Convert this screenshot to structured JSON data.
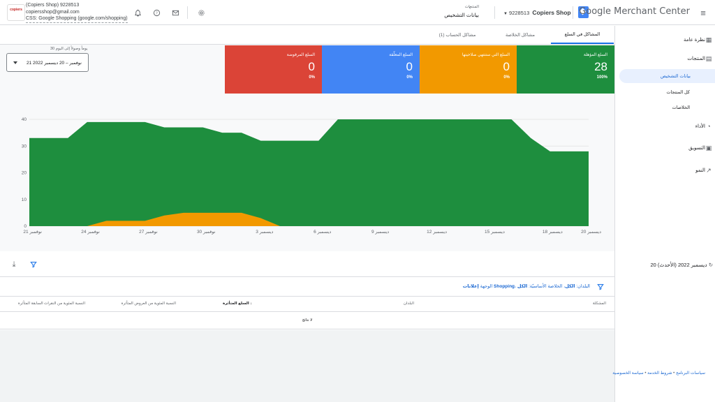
{
  "header": {
    "account_name": "(Copiers Shop) 9228513",
    "account_email": "copiersshop@gmail.com",
    "css_line": "CSS: Google Shopping (google.com/shopping)",
    "logo_text": "copiers",
    "account_selector_id": "9228513",
    "account_selector_name": "Copiers Shop",
    "brand": "Google Merchant Center",
    "crumb_parent": "المنتجات",
    "crumb_current": "بيانات التشخيص"
  },
  "sidebar": {
    "items": [
      {
        "label": "نظرة عامة",
        "icon": "overview-icon"
      },
      {
        "label": "المنتجات",
        "icon": "products-icon"
      },
      {
        "label": "بيانات التشخيص",
        "icon": ""
      },
      {
        "label": "كل المنتجات",
        "icon": ""
      },
      {
        "label": "الخلاصات",
        "icon": ""
      },
      {
        "label": "الأداء",
        "icon": "performance-icon"
      },
      {
        "label": "التسويق",
        "icon": "marketing-icon"
      },
      {
        "label": "النمو",
        "icon": "growth-icon"
      }
    ]
  },
  "tabs": [
    {
      "label": "المشاكل في السلع"
    },
    {
      "label": "مشاكل الخلاصة"
    },
    {
      "label": "مشاكل الحساب (1)"
    }
  ],
  "date": {
    "label": "30 يوماً وصولاً إلى اليوم",
    "range": "21 نوفمبر – 20 ديسمبر 2022"
  },
  "cards": [
    {
      "title": "السلع المؤهلة",
      "value": "28",
      "pct": "100%",
      "color": "#1e8e3e"
    },
    {
      "title": "السلع التي ستنتهي صلاحيتها",
      "value": "0",
      "pct": "0%",
      "color": "#f29900"
    },
    {
      "title": "السلع المعلّقة",
      "value": "0",
      "pct": "0%",
      "color": "#4285f4"
    },
    {
      "title": "السلع المرفوضة",
      "value": "0",
      "pct": "0%",
      "color": "#db4437"
    }
  ],
  "chart_data": {
    "type": "area",
    "x": [
      "21 نوفمبر",
      "22",
      "23",
      "24 نوفمبر",
      "25",
      "26",
      "27 نوفمبر",
      "28",
      "29",
      "30 نوفمبر",
      "1",
      "2",
      "3 ديسمبر",
      "4",
      "5",
      "6 ديسمبر",
      "7",
      "8",
      "9 ديسمبر",
      "10",
      "11",
      "12 ديسمبر",
      "13",
      "14",
      "15 ديسمبر",
      "16",
      "17",
      "18 ديسمبر",
      "19",
      "20 ديسمبر"
    ],
    "xticks": [
      "21 نوفمبر",
      "24 نوفمبر",
      "27 نوفمبر",
      "30 نوفمبر",
      "3 ديسمبر",
      "6 ديسمبر",
      "9 ديسمبر",
      "12 ديسمبر",
      "15 ديسمبر",
      "18 ديسمبر",
      "20 ديسمبر"
    ],
    "xtick_index": [
      0,
      3,
      6,
      9,
      12,
      15,
      18,
      21,
      24,
      27,
      29
    ],
    "series": [
      {
        "color": "#1e8e3e",
        "values": [
          33,
          33,
          33,
          39,
          39,
          39,
          39,
          37,
          37,
          37,
          35,
          35,
          32,
          32,
          32,
          32,
          40,
          40,
          40,
          40,
          40,
          40,
          40,
          40,
          40,
          40,
          33,
          28,
          28,
          28,
          28
        ]
      },
      {
        "color": "#f29900",
        "values": [
          0,
          0,
          0,
          0,
          2,
          2,
          2,
          4,
          5,
          5,
          5,
          5,
          3,
          0,
          0,
          0,
          0,
          0,
          0,
          0,
          0,
          0,
          0,
          0,
          0,
          0,
          0,
          0,
          0,
          0,
          0
        ]
      }
    ],
    "ylim": [
      0,
      40
    ],
    "yticks": [
      0,
      10,
      20,
      30,
      40
    ],
    "grid": true
  },
  "toolbar": {
    "updated": "20 ديسمبر 2022 (الأحدث)"
  },
  "filter": {
    "prefix": "الوجهة ",
    "destinations": "إعلانات Shopping",
    "middle": "، البلدان: ",
    "countries": "الكل",
    "suffix": "، الخلاصة الأساسيّة: ",
    "feed": "الكل"
  },
  "table": {
    "headers": [
      "المشكلة",
      "البلدان",
      "السلع المتأثرة",
      "النسبة المئوية من العروض المتأثرة",
      "النسبة المئوية من النقرات السابقة المتأثرة"
    ],
    "empty": "لا نتائج"
  },
  "footer": {
    "privacy": "سياسة الخصوصية",
    "sep": " • ",
    "terms": "شروط الخدمة",
    "program": "سياسات البرنامج"
  }
}
